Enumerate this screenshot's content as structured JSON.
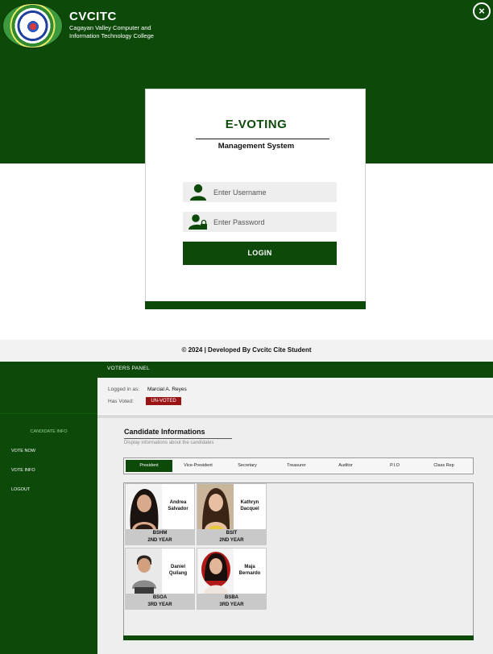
{
  "login": {
    "brand": {
      "name": "CVCITC",
      "subtitle": "Cagayan Valley Computer and Information Technology College"
    },
    "close_icon": "×",
    "card": {
      "title": "E-VOTING",
      "subtitle": "Management System",
      "username_placeholder": "Enter Username",
      "password_placeholder": "Enter Password",
      "login_label": "LOGIN"
    },
    "copyright": "© 2024 | Developed By Cvcitc Cite Student",
    "colors": {
      "primary": "#0d4a0a",
      "white": "#ffffff"
    }
  },
  "panel": {
    "title": "VOTERS PANEL",
    "sidebar": {
      "section": "CANDIDATE INFO",
      "items": [
        "VOTE NOW",
        "VOTE INFO",
        "LOGOUT"
      ]
    },
    "user": {
      "logged_label": "Logged in as:",
      "logged_value": "Marcial A. Reyes",
      "voted_label": "Has Voted:",
      "voted_value": "UN-VOTED"
    },
    "candidates": {
      "title": "Candidate Informations",
      "subtitle": "Display informations about the candidates",
      "tabs": [
        "President",
        "Vice-President",
        "Secretary",
        "Treasurer",
        "Auditor",
        "P.I.O",
        "Class Rep"
      ],
      "active_tab": "President",
      "cards": [
        {
          "first": "Andrea",
          "last": "Salvador",
          "course": "BSHM",
          "year": "2ND YEAR"
        },
        {
          "first": "Kathryn",
          "last": "Dacquel",
          "course": "BSIT",
          "year": "2ND YEAR"
        },
        {
          "first": "Daniel",
          "last": "Quilang",
          "course": "BSOA",
          "year": "3RD YEAR"
        },
        {
          "first": "Maja",
          "last": "Bernardo",
          "course": "BSBA",
          "year": "3RD YEAR"
        }
      ]
    },
    "colors": {
      "badge": "#9a1414",
      "accent": "#8fd48a"
    }
  }
}
